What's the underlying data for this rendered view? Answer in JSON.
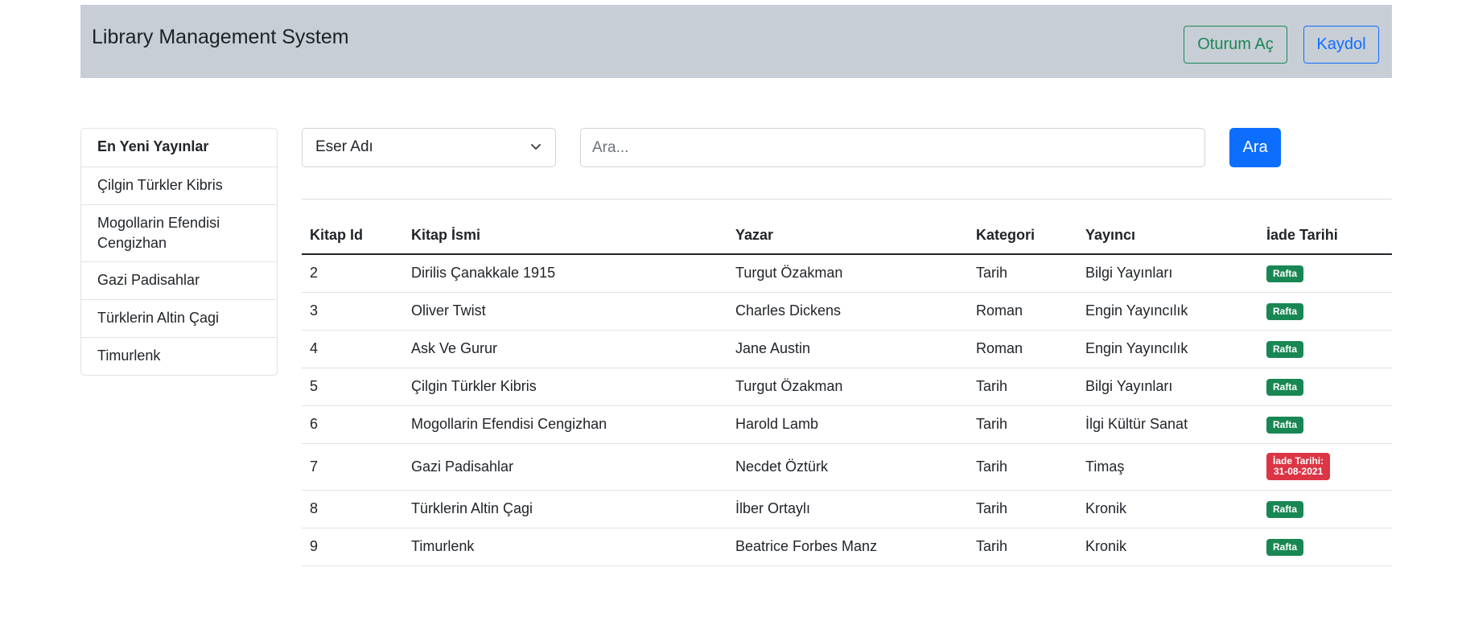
{
  "header": {
    "brand": "Library Management System",
    "login_label": "Oturum Aç",
    "register_label": "Kaydol"
  },
  "sidebar": {
    "items": [
      {
        "label": "En Yeni Yayınlar"
      },
      {
        "label": "Çilgin Türkler Kibris"
      },
      {
        "label": "Mogollarin Efendisi Cengizhan"
      },
      {
        "label": "Gazi Padisahlar"
      },
      {
        "label": "Türklerin Altin Çagi"
      },
      {
        "label": "Timurlenk"
      }
    ]
  },
  "search": {
    "select_value": "Eser Adı",
    "placeholder": "Ara...",
    "button_label": "Ara"
  },
  "table": {
    "headers": [
      "Kitap Id",
      "Kitap İsmi",
      "Yazar",
      "Kategori",
      "Yayıncı",
      "İade Tarihi"
    ],
    "rows": [
      {
        "id": "2",
        "name": "Dirilis Çanakkale 1915",
        "author": "Turgut Özakman",
        "category": "Tarih",
        "publisher": "Bilgi Yayınları",
        "status": "Rafta"
      },
      {
        "id": "3",
        "name": "Oliver Twist",
        "author": "Charles Dickens",
        "category": "Roman",
        "publisher": "Engin Yayıncılık",
        "status": "Rafta"
      },
      {
        "id": "4",
        "name": "Ask Ve Gurur",
        "author": "Jane Austin",
        "category": "Roman",
        "publisher": "Engin Yayıncılık",
        "status": "Rafta"
      },
      {
        "id": "5",
        "name": "Çilgin Türkler Kibris",
        "author": "Turgut Özakman",
        "category": "Tarih",
        "publisher": "Bilgi Yayınları",
        "status": "Rafta"
      },
      {
        "id": "6",
        "name": "Mogollarin Efendisi Cengizhan",
        "author": "Harold Lamb",
        "category": "Tarih",
        "publisher": "İlgi Kültür Sanat",
        "status": "Rafta"
      },
      {
        "id": "7",
        "name": "Gazi Padisahlar",
        "author": "Necdet Öztürk",
        "category": "Tarih",
        "publisher": "Timaş",
        "status_line1": "İade Tarihi:",
        "status_line2": "31-08-2021"
      },
      {
        "id": "8",
        "name": "Türklerin Altin Çagi",
        "author": "İlber Ortaylı",
        "category": "Tarih",
        "publisher": "Kronik",
        "status": "Rafta"
      },
      {
        "id": "9",
        "name": "Timurlenk",
        "author": "Beatrice Forbes Manz",
        "category": "Tarih",
        "publisher": "Kronik",
        "status": "Rafta"
      }
    ]
  },
  "colors": {
    "navbar_bg": "#c8ced6",
    "success": "#198754",
    "primary": "#0d6efd",
    "danger": "#dc3545"
  }
}
